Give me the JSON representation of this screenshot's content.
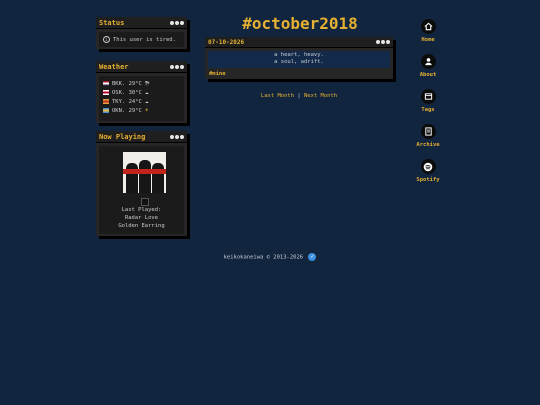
{
  "status": {
    "title": "Status",
    "icon": "info-icon",
    "text": "This user is tired."
  },
  "weather": {
    "title": "Weather",
    "rows": [
      {
        "city": "BKK",
        "temp": "29°C",
        "flag_colors": [
          "#a51931",
          "#ffffff",
          "#2d2a4a"
        ],
        "condition_icon": "rain-cloud-icon",
        "icon_char": "⛈"
      },
      {
        "city": "OSK",
        "temp": "30°C",
        "flag_colors": [
          "#ffffff",
          "#bc002d",
          "#ffffff"
        ],
        "condition_icon": "cloud-icon",
        "icon_char": "☁"
      },
      {
        "city": "TKY",
        "temp": "24°C",
        "flag_colors": [
          "#e0a040",
          "#c03020",
          "#e0a040"
        ],
        "condition_icon": "cloud-icon",
        "icon_char": "☁"
      },
      {
        "city": "OKN",
        "temp": "29°C",
        "flag_colors": [
          "#4a90d9",
          "#f0c040",
          "#4a90d9"
        ],
        "condition_icon": "sun-icon",
        "icon_char": "☀"
      }
    ]
  },
  "now_playing": {
    "title": "Now Playing",
    "label": "Last Played:",
    "song": "Radar Love",
    "artist": "Golden Earring"
  },
  "page": {
    "title": "#october2018"
  },
  "post": {
    "date": "07-10-2026",
    "lines": [
      "a heart, heavy.",
      "a soul, adrift."
    ],
    "tag": "#mine"
  },
  "pager": {
    "prev": "Last Month",
    "separator": "|",
    "next": "Next Month"
  },
  "nav": [
    {
      "label": "Home",
      "icon": "home-icon"
    },
    {
      "label": "About",
      "icon": "user-icon"
    },
    {
      "label": "Tags",
      "icon": "tags-icon"
    },
    {
      "label": "Archive",
      "icon": "archive-icon"
    },
    {
      "label": "Spotify",
      "icon": "spotify-icon"
    }
  ],
  "footer": {
    "text": "keikokaneiwa © 2013-2026",
    "badge_icon": "verified-badge-icon",
    "badge_char": "✓"
  },
  "colors": {
    "background": "#12253f",
    "accent": "#e6b032",
    "panel": "#262626"
  }
}
